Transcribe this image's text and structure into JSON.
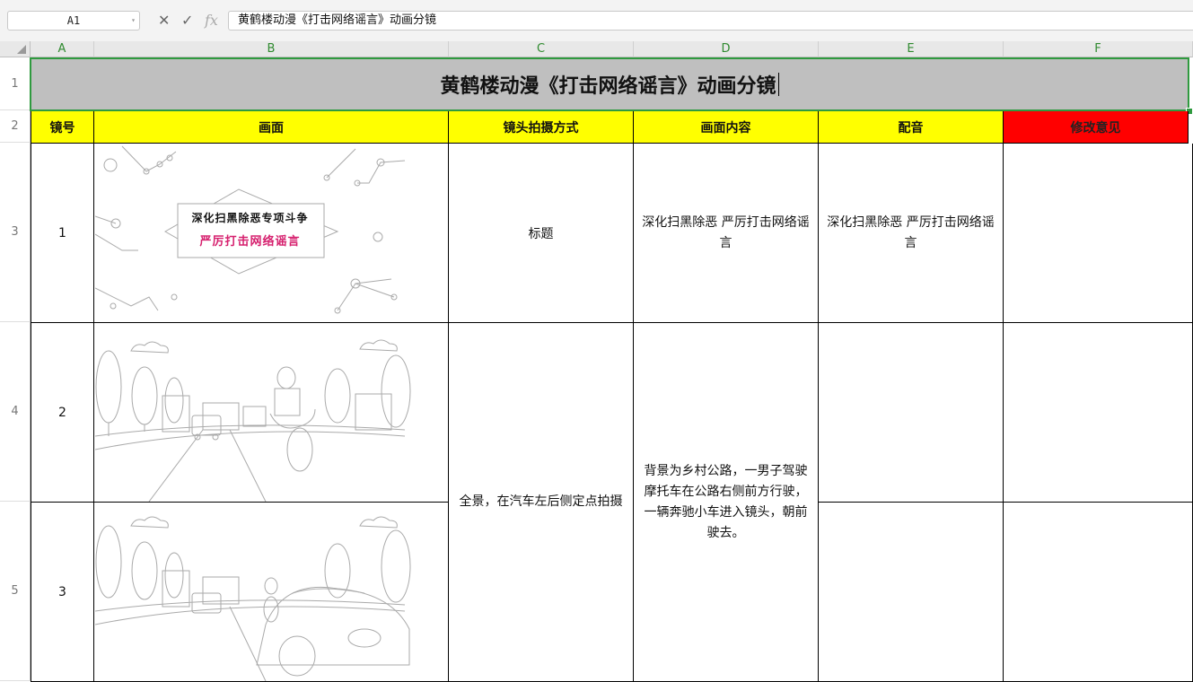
{
  "formula_bar": {
    "cell_ref": "A1",
    "cancel_icon": "close-icon",
    "confirm_icon": "check-icon",
    "fx_label": "fx",
    "content": "黄鹤楼动漫《打击网络谣言》动画分镜"
  },
  "columns": [
    "A",
    "B",
    "C",
    "D",
    "E",
    "F"
  ],
  "rows": [
    "1",
    "2",
    "3",
    "4",
    "5"
  ],
  "sheet": {
    "title": "黄鹤楼动漫《打击网络谣言》动画分镜",
    "headers": {
      "shot_no": "镜号",
      "frame": "画面",
      "camera": "镜头拍摄方式",
      "content": "画面内容",
      "dubbing": "配音",
      "revision": "修改意见"
    },
    "shots": [
      {
        "no": "1",
        "frame_banner_line1": "深化扫黑除恶专项斗争",
        "frame_banner_line2": "严厉打击网络谣言",
        "camera": "标题",
        "content": "深化扫黑除恶 严厉打击网络谣言",
        "dubbing": "深化扫黑除恶 严厉打击网络谣言"
      },
      {
        "no": "2"
      },
      {
        "no": "3"
      }
    ],
    "merged_camera": "全景，在汽车左后侧定点拍摄",
    "merged_content": "背景为乡村公路，一男子驾驶摩托车在公路右侧前方行驶，一辆奔驰小车进入镜头，朝前驶去。"
  },
  "colors": {
    "header_yellow": "#ffff00",
    "header_red": "#ff0000",
    "title_bg": "#bfbfbf",
    "selection_green": "#2f9a3f",
    "banner_red": "#d6206e"
  }
}
